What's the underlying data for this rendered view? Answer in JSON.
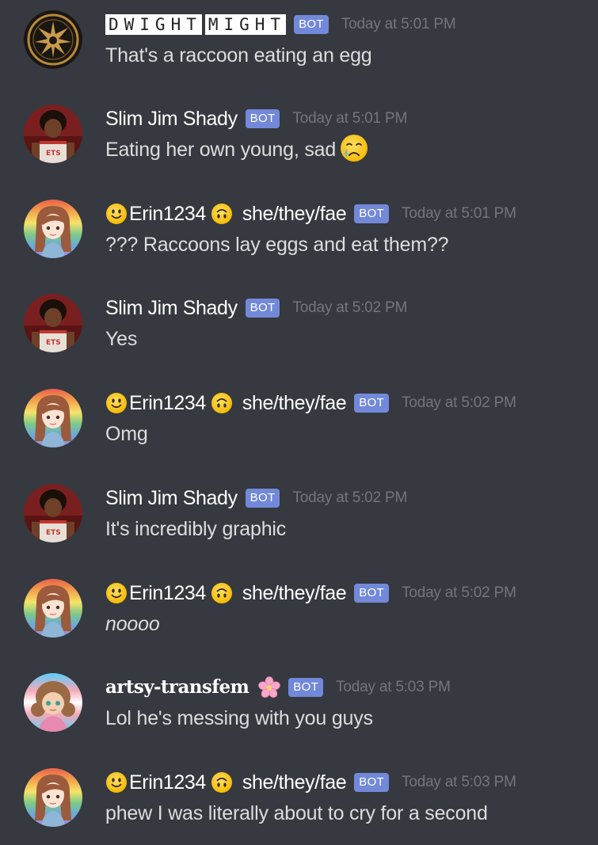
{
  "colors": {
    "background": "#36393f",
    "username": "#ffffff",
    "message_text": "#dcddde",
    "timestamp": "#72767d",
    "bot_badge": "#7289da"
  },
  "messages": [
    {
      "author_parts": [
        "DWIGHT",
        "MIGHT"
      ],
      "badge": "BOT",
      "time": "Today at 5:01 PM",
      "text": "That's a raccoon eating an egg",
      "avatar_icon": "phoenix-emblem-icon"
    },
    {
      "author": "Slim Jim Shady",
      "badge": "BOT",
      "time": "Today at 5:01 PM",
      "text": "Eating her own young, sad",
      "emoji": "crying-face-icon",
      "avatar_icon": "basketball-player-icon"
    },
    {
      "author": "Erin1234",
      "pronouns": "she/they/fae",
      "badge": "BOT",
      "time": "Today at 5:01 PM",
      "text": "??? Raccoons lay eggs and eat them??",
      "avatar_icon": "anime-girl-icon"
    },
    {
      "author": "Slim Jim Shady",
      "badge": "BOT",
      "time": "Today at 5:02 PM",
      "text": "Yes",
      "avatar_icon": "basketball-player-icon"
    },
    {
      "author": "Erin1234",
      "pronouns": "she/they/fae",
      "badge": "BOT",
      "time": "Today at 5:02 PM",
      "text": "Omg",
      "avatar_icon": "anime-girl-icon"
    },
    {
      "author": "Slim Jim Shady",
      "badge": "BOT",
      "time": "Today at 5:02 PM",
      "text": "It's incredibly graphic",
      "avatar_icon": "basketball-player-icon"
    },
    {
      "author": "Erin1234",
      "pronouns": "she/they/fae",
      "badge": "BOT",
      "time": "Today at 5:02 PM",
      "text": "noooo",
      "avatar_icon": "anime-girl-icon"
    },
    {
      "author": "artsy-transfem",
      "badge": "BOT",
      "time": "Today at 5:03 PM",
      "text": "Lol he's messing with you guys",
      "avatar_icon": "cartoon-girl-icon"
    },
    {
      "author": "Erin1234",
      "pronouns": "she/they/fae",
      "badge": "BOT",
      "time": "Today at 5:03 PM",
      "text": "phew I was literally about to cry for a second",
      "avatar_icon": "anime-girl-icon"
    }
  ]
}
